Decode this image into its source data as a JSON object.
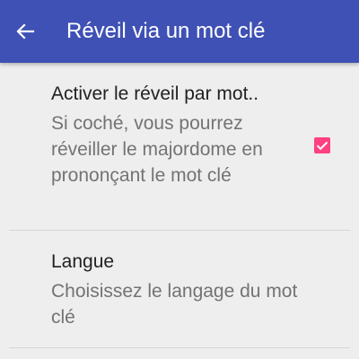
{
  "toolbar": {
    "back_icon": "arrow-left-icon",
    "title": "Réveil via un mot clé",
    "background": "#3f51b5"
  },
  "preferences": [
    {
      "title": "Activer le réveil par mot..",
      "summary": "Si coché, vous pourrez réveiller le majordome en prononçant le mot clé",
      "checked": true
    },
    {
      "title": "Langue",
      "summary": "Choisissez le langage du mot clé"
    }
  ],
  "colors": {
    "accent": "#ff4081",
    "primary": "#3f51b5"
  }
}
